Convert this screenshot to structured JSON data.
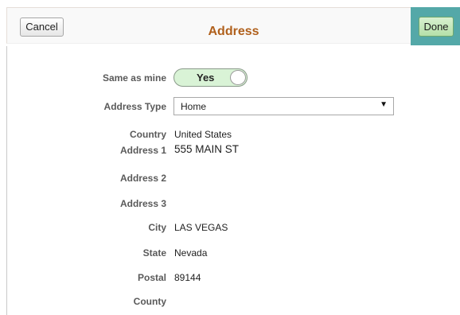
{
  "header": {
    "title": "Address",
    "cancel_label": "Cancel",
    "done_label": "Done"
  },
  "form": {
    "same_as_mine": {
      "label": "Same as mine",
      "value": "Yes"
    },
    "address_type": {
      "label": "Address Type",
      "value": "Home"
    },
    "country": {
      "label": "Country",
      "value": "United States"
    },
    "address1": {
      "label": "Address 1",
      "value": "555 MAIN ST"
    },
    "address2": {
      "label": "Address 2",
      "value": ""
    },
    "address3": {
      "label": "Address 3",
      "value": ""
    },
    "city": {
      "label": "City",
      "value": "LAS VEGAS"
    },
    "state": {
      "label": "State",
      "value": "Nevada"
    },
    "postal": {
      "label": "Postal",
      "value": "89144"
    },
    "county": {
      "label": "County",
      "value": ""
    }
  },
  "colors": {
    "title": "#b0601c",
    "done_highlight": "#54a8a8",
    "toggle_on": "#d9f3d6"
  }
}
